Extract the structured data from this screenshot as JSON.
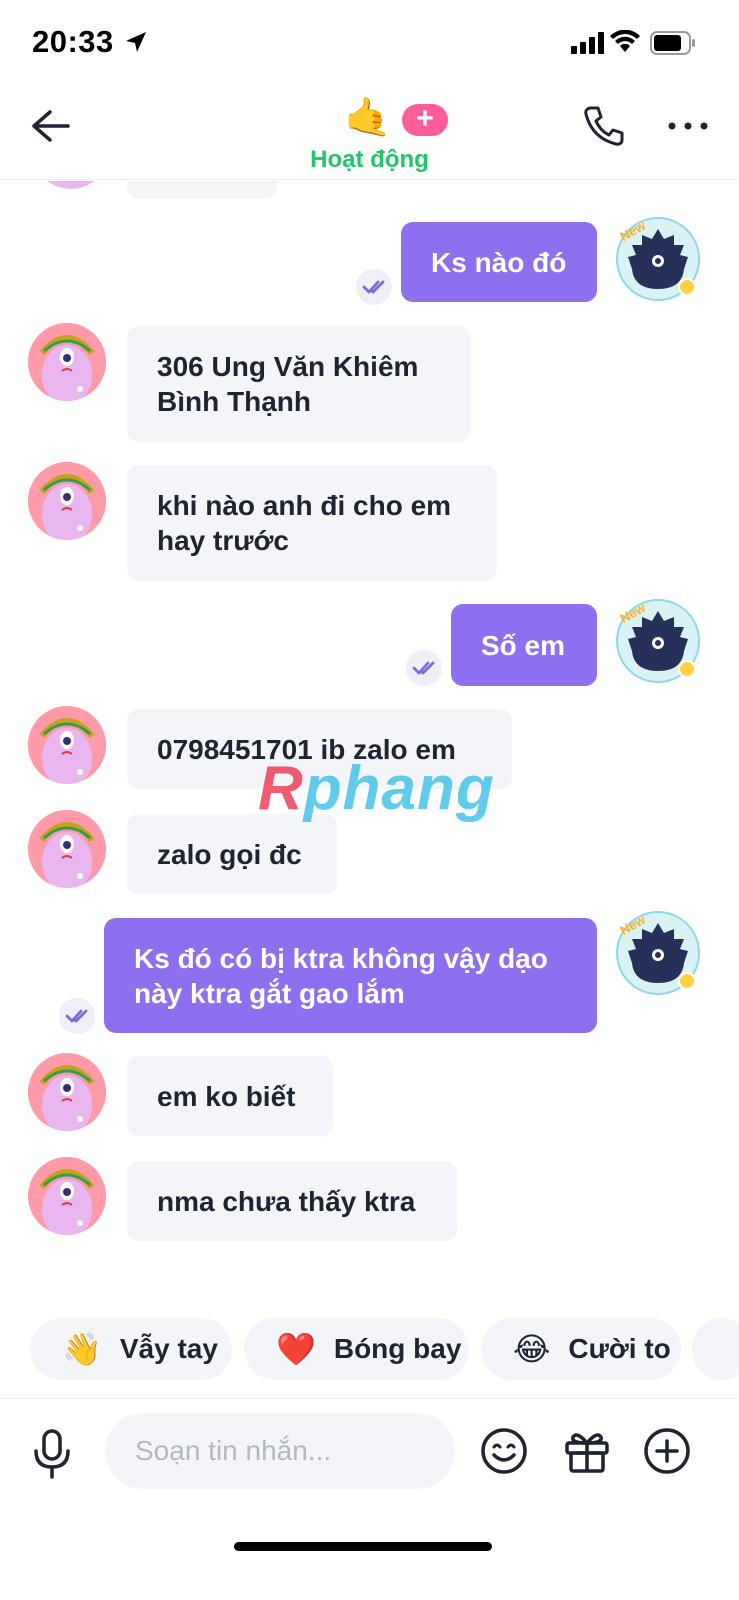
{
  "status_bar": {
    "time": "20:33",
    "icons": [
      "location-arrow-icon",
      "signal-icon",
      "wifi-icon",
      "battery-icon"
    ]
  },
  "header": {
    "status_emoji": "🤙",
    "add_label": "+",
    "activity_status": "Hoạt động",
    "icons": [
      "back-arrow-icon",
      "phone-icon",
      "more-icon"
    ],
    "activity_color": "#23c46b"
  },
  "messages": [
    {
      "side": "out",
      "text": "Ks nào đó",
      "seen": true
    },
    {
      "side": "in",
      "text": "306 Ung Văn Khiêm\nBình Thạnh"
    },
    {
      "side": "in",
      "text": "khi nào anh đi cho em\nhay trước"
    },
    {
      "side": "out",
      "text": "Số em",
      "seen": true
    },
    {
      "side": "in",
      "text": "0798451701 ib zalo em"
    },
    {
      "side": "in",
      "text": "zalo gọi đc"
    },
    {
      "side": "out",
      "text": "Ks đó có bị ktra không vậy dạo\nnày ktra gắt gao lắm",
      "seen": true
    },
    {
      "side": "in",
      "text": "em ko biết"
    },
    {
      "side": "in",
      "text": "nma chưa thấy ktra"
    }
  ],
  "avatar_badge": "New",
  "watermark": {
    "first": "R",
    "rest": "phang"
  },
  "quick_reactions": [
    {
      "emoji": "👋",
      "label": "Vẫy tay"
    },
    {
      "emoji": "❤️",
      "label": "Bóng bay"
    },
    {
      "emoji": "😂",
      "label": "Cười to"
    }
  ],
  "composer": {
    "placeholder": "Soạn tin nhắn...",
    "value": "",
    "icons": [
      "microphone-icon",
      "emoji-icon",
      "gift-icon",
      "plus-icon"
    ]
  },
  "colors": {
    "outgoing_bubble": "#8e6ff0",
    "incoming_bubble": "#f4f5f8",
    "add_pill": "#ff5c9a"
  }
}
